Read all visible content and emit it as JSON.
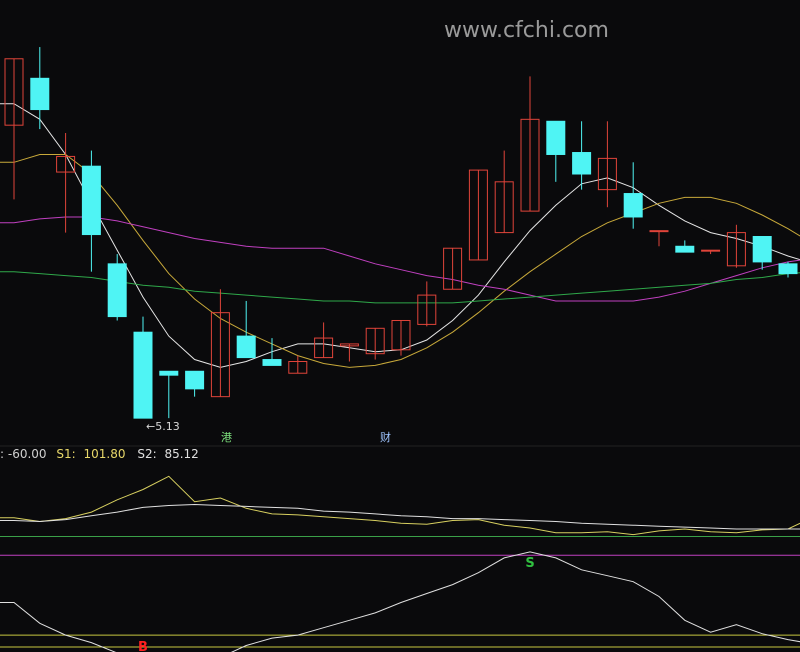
{
  "watermark": "www.cfchi.com",
  "colors": {
    "bg": "#0a0a0c",
    "up": "#e0443a",
    "down": "#4ff4f4",
    "ma_white": "#e6e6e6",
    "ma_yellow": "#c8a93a",
    "ma_magenta": "#c040c0",
    "ma_green": "#2fa84a",
    "s1_yellow": "#d8d060",
    "s2_white": "#e0e0e0",
    "level_green": "#3aa048",
    "level_magenta": "#c040c0",
    "level_yellow": "#c8c840",
    "buy_red": "#ff2020",
    "sell_green": "#30c040"
  },
  "status_bar": {
    "left_label": ": -60.00",
    "s1_label": "S1:",
    "s1_value": "101.80",
    "s2_label": "S2:",
    "s2_value": "85.12"
  },
  "annotations": {
    "low_price": "←5.13",
    "badge_gang": "港",
    "badge_cai": "财",
    "sell_signal": "S",
    "buy_signal": "B"
  },
  "chart_data": [
    {
      "type": "candlestick",
      "title": "",
      "candles": [
        {
          "i": 0,
          "open": 6.43,
          "high": 6.67,
          "low": 6.05,
          "close": 6.77
        },
        {
          "i": 1,
          "open": 6.67,
          "high": 6.83,
          "low": 6.41,
          "close": 6.51
        },
        {
          "i": 2,
          "open": 6.19,
          "high": 6.39,
          "low": 5.88,
          "close": 6.27
        },
        {
          "i": 3,
          "open": 6.22,
          "high": 6.3,
          "low": 5.68,
          "close": 5.87
        },
        {
          "i": 4,
          "open": 5.72,
          "high": 5.77,
          "low": 5.43,
          "close": 5.45
        },
        {
          "i": 5,
          "open": 5.37,
          "high": 5.45,
          "low": 4.93,
          "close": 4.93
        },
        {
          "i": 6,
          "open": 5.17,
          "high": 5.17,
          "low": 4.93,
          "close": 5.15
        },
        {
          "i": 7,
          "open": 5.17,
          "high": 5.17,
          "low": 5.04,
          "close": 5.08
        },
        {
          "i": 8,
          "open": 5.04,
          "high": 5.59,
          "low": 5.05,
          "close": 5.47
        },
        {
          "i": 9,
          "open": 5.35,
          "high": 5.53,
          "low": 5.3,
          "close": 5.24
        },
        {
          "i": 10,
          "open": 5.23,
          "high": 5.34,
          "low": 5.24,
          "close": 5.2
        },
        {
          "i": 11,
          "open": 5.16,
          "high": 5.25,
          "low": 5.23,
          "close": 5.22
        },
        {
          "i": 12,
          "open": 5.24,
          "high": 5.42,
          "low": 5.24,
          "close": 5.34
        },
        {
          "i": 13,
          "open": 5.3,
          "high": 5.29,
          "low": 5.22,
          "close": 5.31
        },
        {
          "i": 14,
          "open": 5.26,
          "high": 5.39,
          "low": 5.23,
          "close": 5.39
        },
        {
          "i": 15,
          "open": 5.28,
          "high": 5.37,
          "low": 5.25,
          "close": 5.43
        },
        {
          "i": 16,
          "open": 5.41,
          "high": 5.63,
          "low": 5.4,
          "close": 5.56
        },
        {
          "i": 17,
          "open": 5.59,
          "high": 5.74,
          "low": 5.59,
          "close": 5.8
        },
        {
          "i": 18,
          "open": 5.74,
          "high": 5.89,
          "low": 5.81,
          "close": 6.2
        },
        {
          "i": 19,
          "open": 5.88,
          "high": 6.3,
          "low": 5.88,
          "close": 6.14
        },
        {
          "i": 20,
          "open": 5.99,
          "high": 6.68,
          "low": 6.19,
          "close": 6.46
        },
        {
          "i": 21,
          "open": 6.45,
          "high": 6.38,
          "low": 6.14,
          "close": 6.28
        },
        {
          "i": 22,
          "open": 6.29,
          "high": 6.45,
          "low": 6.1,
          "close": 6.18
        },
        {
          "i": 23,
          "open": 6.1,
          "high": 6.45,
          "low": 6.01,
          "close": 6.26
        },
        {
          "i": 24,
          "open": 6.08,
          "high": 6.24,
          "low": 5.9,
          "close": 5.96
        },
        {
          "i": 25,
          "open": 5.89,
          "high": 5.89,
          "low": 5.81,
          "close": 5.89
        },
        {
          "i": 26,
          "open": 5.81,
          "high": 5.84,
          "low": 5.79,
          "close": 5.78
        },
        {
          "i": 27,
          "open": 5.79,
          "high": 5.78,
          "low": 5.77,
          "close": 5.79
        },
        {
          "i": 28,
          "open": 5.71,
          "high": 5.92,
          "low": 5.7,
          "close": 5.88
        },
        {
          "i": 29,
          "open": 5.86,
          "high": 5.83,
          "low": 5.69,
          "close": 5.73
        },
        {
          "i": 30,
          "open": 5.72,
          "high": 5.73,
          "low": 5.65,
          "close": 5.67
        },
        {
          "i": 31,
          "open": 5.64,
          "high": 5.57,
          "low": 5.42,
          "close": 5.46
        }
      ],
      "ma_series": [
        {
          "color_key": "ma_white",
          "values": [
            6.54,
            6.46,
            6.28,
            6.03,
            5.79,
            5.55,
            5.35,
            5.23,
            5.19,
            5.22,
            5.27,
            5.31,
            5.31,
            5.29,
            5.27,
            5.28,
            5.33,
            5.43,
            5.56,
            5.73,
            5.89,
            6.02,
            6.13,
            6.16,
            6.11,
            6.02,
            5.94,
            5.88,
            5.85,
            5.81,
            5.76,
            5.72
          ]
        },
        {
          "color_key": "ma_yellow",
          "values": [
            6.24,
            6.28,
            6.28,
            6.18,
            6.02,
            5.84,
            5.67,
            5.54,
            5.44,
            5.37,
            5.31,
            5.25,
            5.21,
            5.19,
            5.2,
            5.23,
            5.29,
            5.37,
            5.47,
            5.58,
            5.68,
            5.77,
            5.86,
            5.93,
            5.98,
            6.03,
            6.06,
            6.06,
            6.03,
            5.97,
            5.9,
            5.82
          ]
        },
        {
          "color_key": "ma_magenta",
          "values": [
            5.93,
            5.95,
            5.96,
            5.96,
            5.94,
            5.91,
            5.88,
            5.85,
            5.83,
            5.81,
            5.8,
            5.8,
            5.8,
            5.76,
            5.72,
            5.69,
            5.66,
            5.64,
            5.61,
            5.59,
            5.56,
            5.53,
            5.53,
            5.53,
            5.53,
            5.55,
            5.58,
            5.62,
            5.66,
            5.7,
            5.73,
            5.75
          ]
        },
        {
          "color_key": "ma_green",
          "values": [
            5.68,
            5.67,
            5.66,
            5.65,
            5.63,
            5.61,
            5.6,
            5.58,
            5.57,
            5.56,
            5.55,
            5.54,
            5.53,
            5.53,
            5.52,
            5.52,
            5.52,
            5.52,
            5.53,
            5.54,
            5.55,
            5.56,
            5.57,
            5.58,
            5.59,
            5.6,
            5.61,
            5.62,
            5.64,
            5.65,
            5.67,
            5.68
          ]
        }
      ],
      "ylim": [
        4.9,
        7.03
      ]
    },
    {
      "type": "line",
      "series": [
        {
          "name": "S1",
          "color_key": "s1_yellow",
          "values": [
            100,
            96,
            99,
            106,
            119,
            130,
            144,
            117,
            121,
            110,
            104,
            103,
            101,
            99,
            97,
            94,
            93,
            97,
            98,
            92,
            89,
            84,
            84,
            85,
            82,
            86,
            88,
            85,
            84,
            87,
            88,
            101
          ]
        },
        {
          "name": "S2",
          "color_key": "s2_white",
          "values": [
            97,
            96,
            98,
            102,
            106,
            111,
            113,
            114,
            113,
            112,
            111,
            110,
            107,
            106,
            104,
            102,
            101,
            99,
            99,
            98,
            97,
            96,
            94,
            93,
            92,
            91,
            90,
            89,
            88,
            88,
            88,
            88
          ]
        }
      ],
      "levels": [
        {
          "value": 80,
          "color_key": "level_green"
        },
        {
          "value": 60,
          "color_key": "level_magenta"
        }
      ],
      "ylim": [
        55,
        155
      ]
    },
    {
      "type": "line",
      "series": [
        {
          "color_key": "s2_white",
          "values": [
            62,
            48,
            40,
            35,
            28,
            22,
            18,
            21,
            25,
            33,
            38,
            40,
            45,
            50,
            55,
            62,
            68,
            74,
            82,
            92,
            96,
            92,
            84,
            80,
            76,
            66,
            50,
            42,
            47,
            41,
            37,
            34
          ]
        }
      ],
      "levels": [
        {
          "value": 40,
          "color_key": "level_yellow"
        },
        {
          "value": 32,
          "color_key": "level_yellow"
        }
      ],
      "signals": [
        {
          "i": 5,
          "kind": "buy"
        },
        {
          "i": 20,
          "kind": "sell"
        }
      ],
      "ylim": [
        30,
        100
      ]
    }
  ]
}
